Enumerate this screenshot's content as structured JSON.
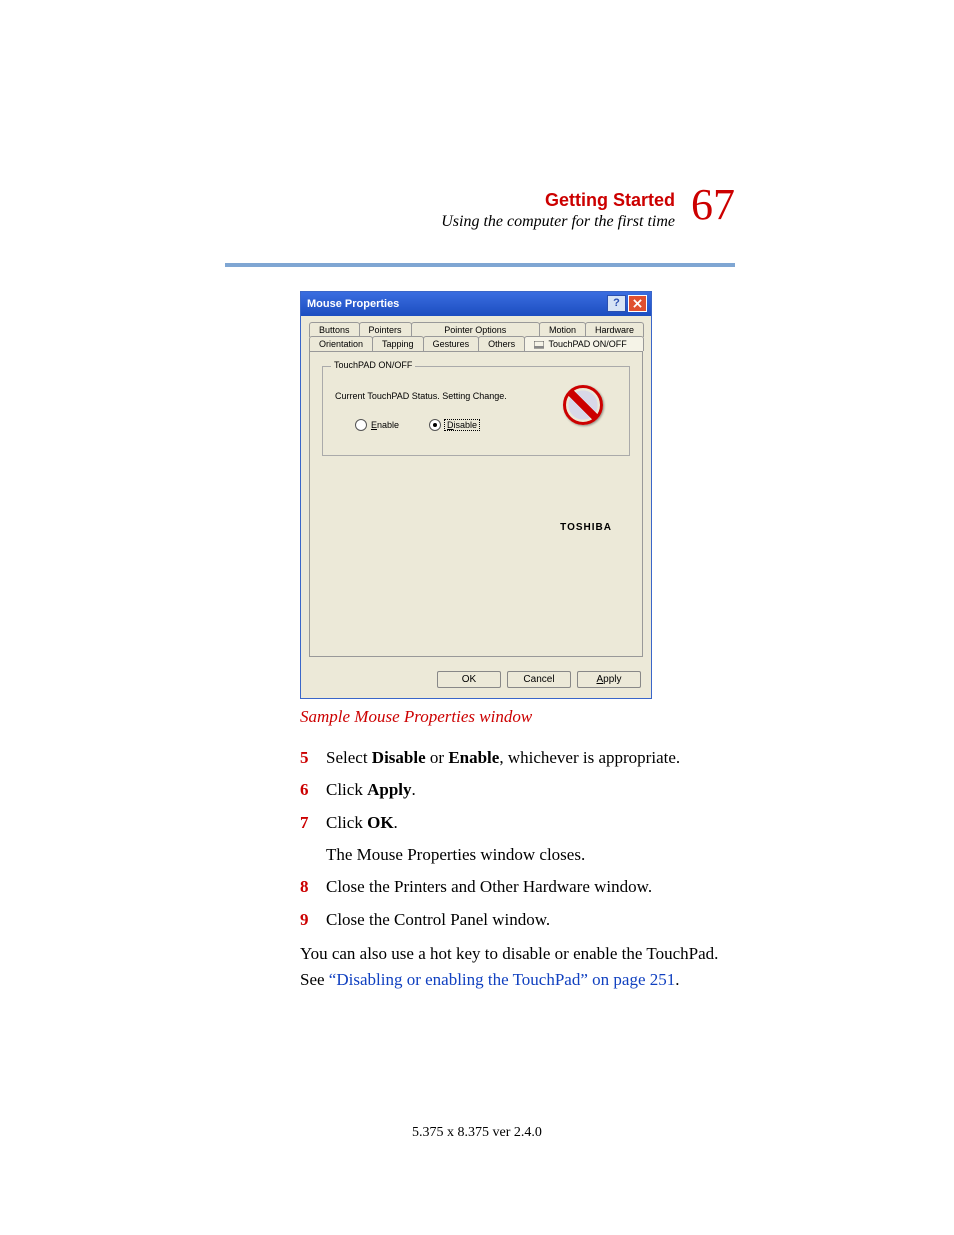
{
  "header": {
    "title": "Getting Started",
    "subtitle": "Using the computer for the first time",
    "page_number": "67"
  },
  "screenshot": {
    "window_title": "Mouse Properties",
    "tabs_row1": [
      "Buttons",
      "Pointers",
      "Pointer Options",
      "Motion",
      "Hardware"
    ],
    "tabs_row2": [
      "Orientation",
      "Tapping",
      "Gestures",
      "Others",
      "TouchPAD ON/OFF"
    ],
    "selected_tab": "TouchPAD ON/OFF",
    "group_label": "TouchPAD ON/OFF",
    "status_text": "Current TouchPAD Status. Setting Change.",
    "radio_enable": "Enable",
    "radio_disable": "Disable",
    "selected_radio": "Disable",
    "brand": "TOSHIBA",
    "btn_ok": "OK",
    "btn_cancel": "Cancel",
    "btn_apply": "Apply"
  },
  "caption": "Sample Mouse Properties window",
  "steps": {
    "s5": {
      "num": "5",
      "pre": "Select ",
      "b1": "Disable",
      "mid": " or ",
      "b2": "Enable",
      "post": ", whichever is appropriate."
    },
    "s6": {
      "num": "6",
      "pre": "Click ",
      "b1": "Apply",
      "post": "."
    },
    "s7": {
      "num": "7",
      "pre": "Click ",
      "b1": "OK",
      "post": "."
    },
    "s7_after": "The Mouse Properties window closes.",
    "s8": {
      "num": "8",
      "text": "Close the Printers and Other Hardware window."
    },
    "s9": {
      "num": "9",
      "text": "Close the Control Panel window."
    }
  },
  "closing": {
    "line1": "You can also use a hot key to disable or enable the TouchPad.",
    "line2_pre": "See ",
    "line2_link": "“Disabling or enabling the TouchPad” on page 251",
    "line2_post": "."
  },
  "footer": "5.375 x 8.375 ver 2.4.0"
}
